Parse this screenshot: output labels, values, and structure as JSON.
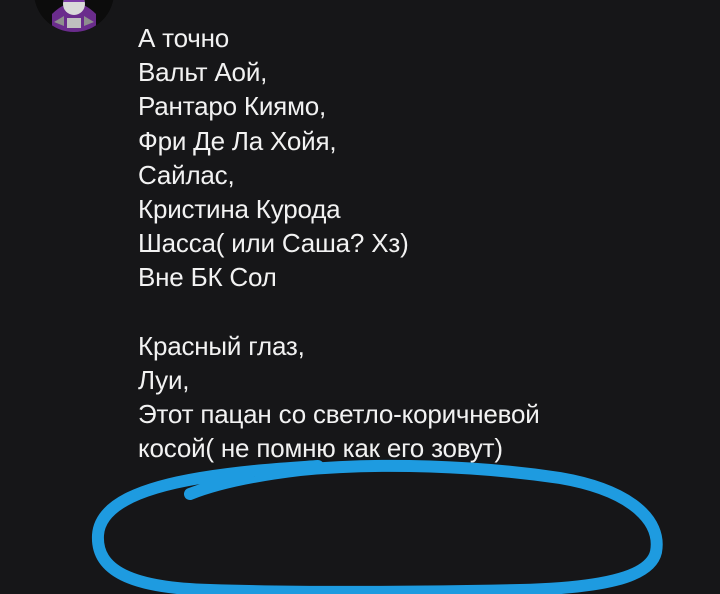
{
  "message": {
    "lines": [
      "А точно",
      "Вальт Аой,",
      "Рантаро Киямо,",
      "Фри Де Ла Хойя,",
      "Сайлас,",
      "Кристина Курода",
      "Шасса( или Саша? Хз)",
      "Вне БК Сол",
      "",
      "Красный глаз,",
      "Луи,",
      "Этот пацан со светло-коричневой",
      "косой( не помню как его зовут)"
    ]
  },
  "colors": {
    "background": "#161618",
    "text": "#f2f2f2",
    "highlight": "#1e9be0"
  },
  "avatar": {
    "icon": "user-avatar-icon"
  }
}
